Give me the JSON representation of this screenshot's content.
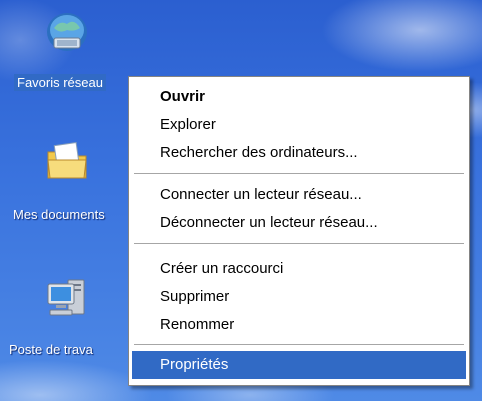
{
  "desktop": {
    "icons": [
      {
        "label": "Favoris réseau",
        "icon": "network-places-icon",
        "selected": true
      },
      {
        "label": "Mes documents",
        "icon": "my-documents-icon",
        "selected": false
      },
      {
        "label": "Poste de trava",
        "icon": "my-computer-icon",
        "selected": false
      }
    ]
  },
  "context_menu": {
    "items": [
      {
        "label": "Ouvrir",
        "bold": true
      },
      {
        "label": "Explorer"
      },
      {
        "label": "Rechercher des ordinateurs..."
      },
      {
        "label": "Connecter un lecteur réseau..."
      },
      {
        "label": "Déconnecter un lecteur réseau..."
      },
      {
        "label": "Créer un raccourci"
      },
      {
        "label": "Supprimer"
      },
      {
        "label": "Renommer"
      },
      {
        "label": "Propriétés",
        "highlighted": true
      }
    ]
  },
  "colors": {
    "desktop_blue": "#3a73de",
    "selection": "#316ac5",
    "menu_border": "#848484"
  }
}
